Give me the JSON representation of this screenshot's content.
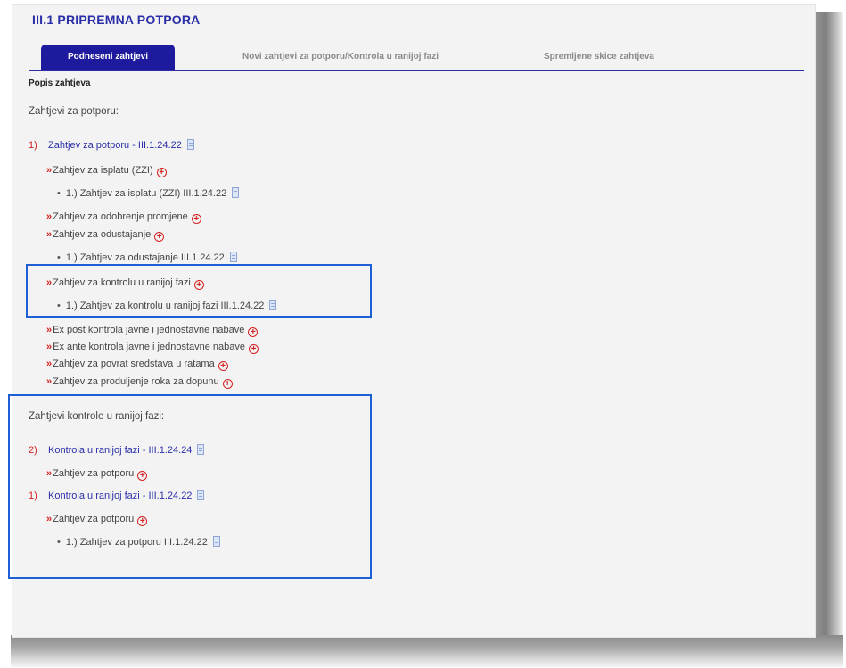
{
  "page": {
    "title": "III.1 PRIPREMNA POTPORA",
    "tabs": [
      {
        "label": "Podneseni zahtjevi"
      },
      {
        "label": "Novi zahtjevi za potporu/Kontrola u ranijoj fazi"
      },
      {
        "label": "Spremljene skice zahtjeva"
      }
    ],
    "section_label": "Popis zahtjeva"
  },
  "requests": {
    "heading": "Zahtjevi za potporu:",
    "group1": {
      "number": "1)",
      "label": "Zahtjev za potporu - III.1.24.22",
      "items": [
        {
          "label": "Zahtjev za isplatu (ZZI)"
        },
        {
          "label": "1.) Zahtjev za isplatu (ZZI) III.1.24.22"
        },
        {
          "label": "Zahtjev za odobrenje promjene"
        },
        {
          "label": "Zahtjev za odustajanje"
        },
        {
          "label": "1.) Zahtjev za odustajanje III.1.24.22"
        },
        {
          "label": "Zahtjev za kontrolu u ranijoj fazi"
        },
        {
          "label": "1.) Zahtjev za kontrolu u ranijoj fazi III.1.24.22"
        },
        {
          "label": "Ex post kontrola javne i jednostavne nabave"
        },
        {
          "label": "Ex ante kontrola javne i jednostavne nabave"
        },
        {
          "label": "Zahtjev za povrat sredstava u ratama"
        },
        {
          "label": "Zahtjev za produljenje roka za dopunu"
        }
      ]
    }
  },
  "controls": {
    "heading": "Zahtjevi kontrole u ranijoj fazi:",
    "group2": {
      "number": "2)",
      "label": "Kontrola u ranijoj fazi - III.1.24.24",
      "sub": "Zahtjev za potporu"
    },
    "group3": {
      "number": "1)",
      "label": "Kontrola u ranijoj fazi - III.1.24.22",
      "sub": "Zahtjev za potporu",
      "doc": "1.) Zahtjev za potporu III.1.24.22"
    }
  },
  "colors": {
    "tab_active_bg": "#1e1a9e",
    "link": "#2a2fa8",
    "accent_red": "#d42121",
    "highlight_box": "#1f5fd6"
  },
  "icons": {
    "expand": "plus-circle-icon",
    "document": "document-icon",
    "chevron": "double-chevron-right-icon"
  }
}
